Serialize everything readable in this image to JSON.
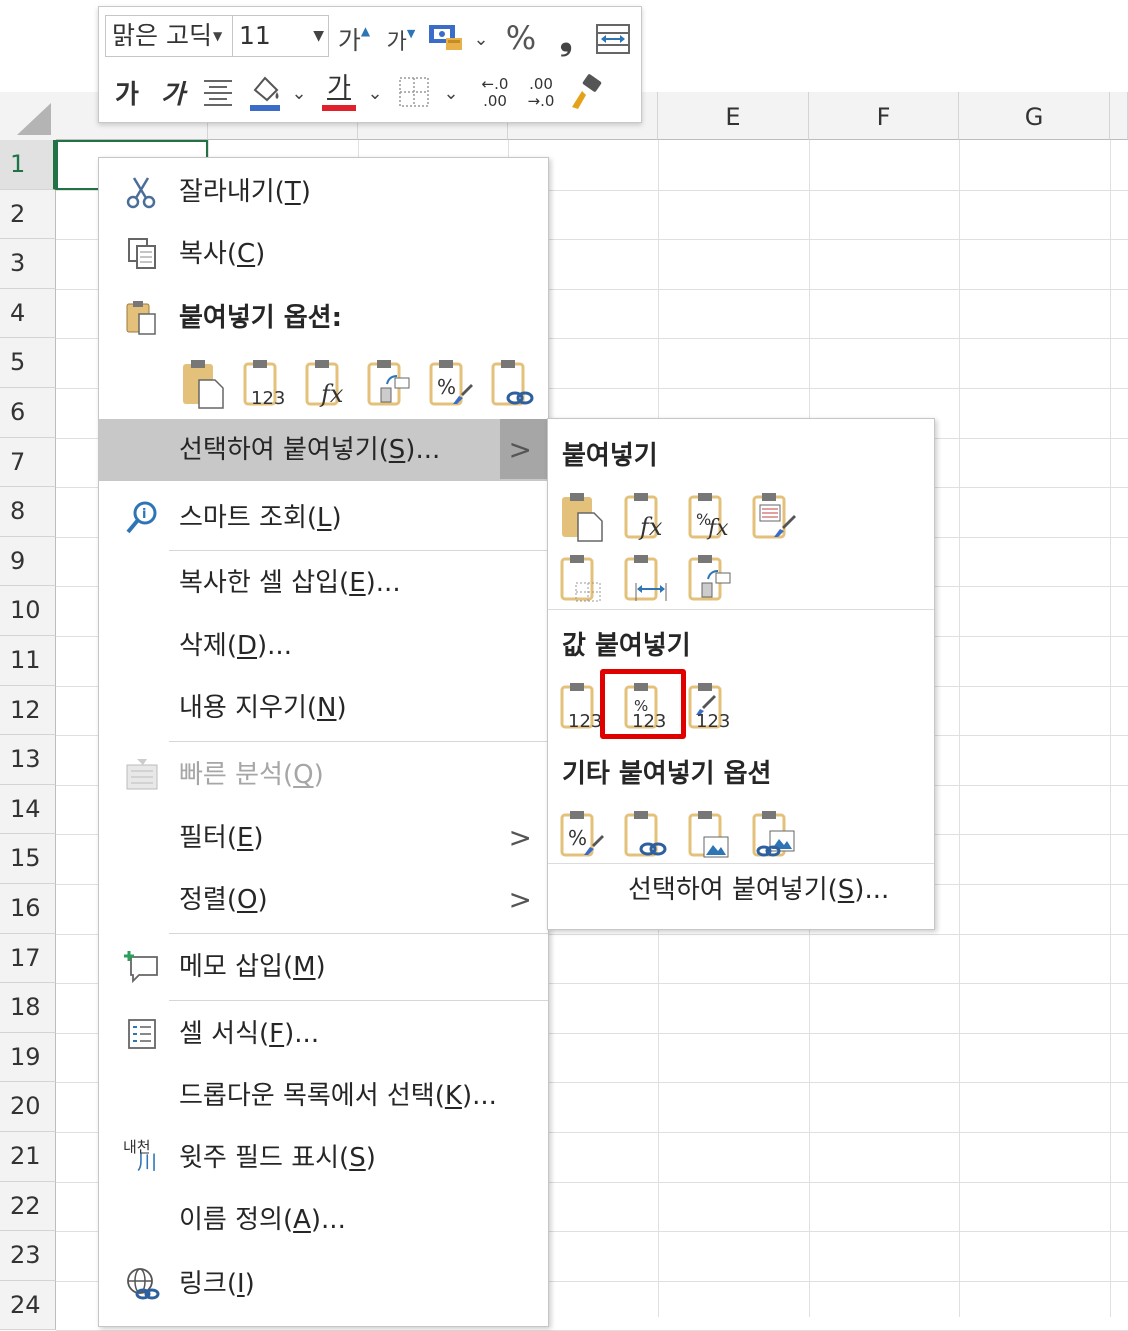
{
  "sheet": {
    "columns": [
      "",
      "",
      "",
      "",
      "E",
      "F",
      "G"
    ],
    "rows": [
      "1",
      "2",
      "3",
      "4",
      "5",
      "6",
      "7",
      "8",
      "9",
      "10",
      "11",
      "12",
      "13",
      "14",
      "15",
      "16",
      "17",
      "18",
      "19",
      "20",
      "21",
      "22",
      "23",
      "24"
    ],
    "active_row": "1"
  },
  "minibar": {
    "font_name": "맑은 고딕",
    "font_size": "11",
    "grow_font": "가",
    "shrink_font": "가",
    "percent": "%",
    "comma": "❟",
    "bold": "가",
    "italic": "가",
    "font_color_letter": "가",
    "inc_decimal_top": "←.0",
    "inc_decimal_bottom": ".00",
    "dec_decimal_top": ".00",
    "dec_decimal_bottom": "→.0",
    "accent_font_color": "#e0202a",
    "accent_fill_color": "#3b6cc7"
  },
  "context_menu": {
    "cut": {
      "label": "잘라내기(",
      "key": "T",
      "suffix": ")"
    },
    "copy": {
      "label": "복사(",
      "key": "C",
      "suffix": ")"
    },
    "paste_options": "붙여넣기 옵션:",
    "paste_special": {
      "label": "선택하여 붙여넣기(",
      "key": "S",
      "suffix": ")..."
    },
    "smart_lookup": {
      "label": "스마트 조회(",
      "key": "L",
      "suffix": ")"
    },
    "insert_copied": {
      "label": "복사한 셀 삽입(",
      "key": "E",
      "suffix": ")..."
    },
    "delete": {
      "label": "삭제(",
      "key": "D",
      "suffix": ")..."
    },
    "clear_contents": {
      "label": "내용 지우기(",
      "key": "N",
      "suffix": ")"
    },
    "quick_analysis": {
      "label": "빠른 분석(",
      "key": "Q",
      "suffix": ")"
    },
    "filter": {
      "label": "필터(",
      "key": "E",
      "suffix": ")"
    },
    "sort": {
      "label": "정렬(",
      "key": "O",
      "suffix": ")"
    },
    "insert_comment": {
      "label": "메모 삽입(",
      "key": "M",
      "suffix": ")"
    },
    "format_cells": {
      "label": "셀 서식(",
      "key": "F",
      "suffix": ")..."
    },
    "pick_from_list": {
      "label": "드롭다운 목록에서 선택(",
      "key": "K",
      "suffix": ")..."
    },
    "phonetic": {
      "label": "윗주 필드 표시(",
      "key": "S",
      "suffix": ")"
    },
    "define_name": {
      "label": "이름 정의(",
      "key": "A",
      "suffix": ")..."
    },
    "link": {
      "label": "링크(",
      "key": "I",
      "suffix": ")"
    },
    "phonetic_icon_text": "내천",
    "submenu_arrow": ">"
  },
  "submenu": {
    "paste_header": "붙여넣기",
    "values_header": "값 붙여넣기",
    "other_header": "기타 붙여넣기 옵션",
    "paste_special": {
      "label": "선택하여 붙여넣기(",
      "key": "S",
      "suffix": ")..."
    },
    "highlight_color": "#e00000"
  }
}
